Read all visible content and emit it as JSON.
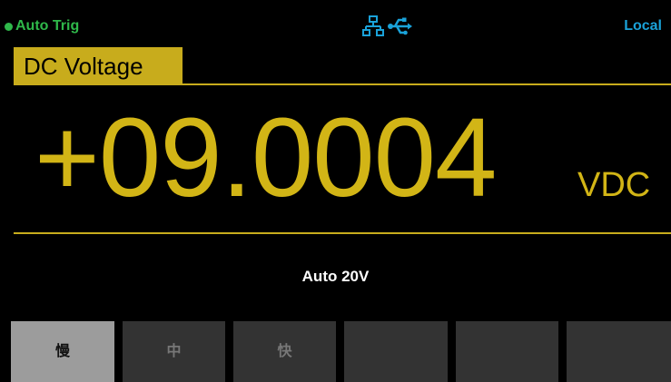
{
  "status": {
    "trigger_mode": "Auto  Trig",
    "remote_state": "Local",
    "icons": [
      "lan-icon",
      "usb-icon"
    ]
  },
  "function": {
    "label": "DC Voltage"
  },
  "reading": {
    "value": "+09.0004",
    "unit": "VDC"
  },
  "range": {
    "text": "Auto  20V"
  },
  "softkeys": [
    {
      "label": "慢",
      "selected": true
    },
    {
      "label": "中",
      "selected": false
    },
    {
      "label": "快",
      "selected": false
    },
    {
      "label": "",
      "selected": false
    },
    {
      "label": "",
      "selected": false
    },
    {
      "label": "",
      "selected": false
    }
  ],
  "colors": {
    "background": "#000000",
    "accent_yellow": "#c8ac1c",
    "reading_yellow": "#d2b516",
    "trigger_green": "#2fb84a",
    "local_blue": "#1aa2d9",
    "softkey_bg": "#333333",
    "softkey_selected_bg": "#9c9c9c"
  }
}
